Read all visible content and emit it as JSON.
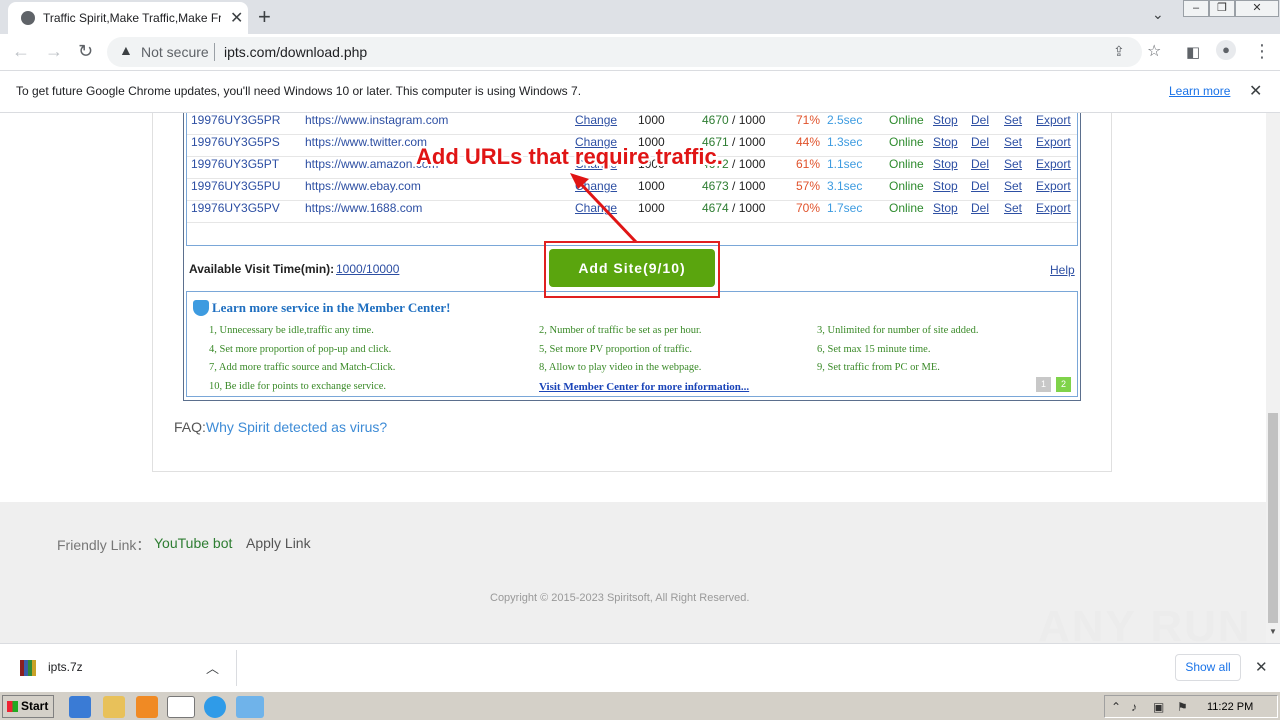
{
  "browser": {
    "tab_title": "Traffic Spirit,Make Traffic,Make Free",
    "security_label": "Not secure",
    "url": "ipts.com/download.php",
    "infobar_message": "To get future Google Chrome updates, you'll need Windows 10 or later. This computer is using Windows 7.",
    "infobar_link": "Learn more"
  },
  "sites": [
    {
      "id": "19976UY3G5PR",
      "url": "https://www.instagram.com",
      "change": "Change",
      "total": "1000",
      "visits": "4670",
      "visits_total": "1000",
      "pct": "71%",
      "sec": "2.5sec",
      "status": "Online",
      "stop": "Stop",
      "del": "Del",
      "set": "Set",
      "export": "Export"
    },
    {
      "id": "19976UY3G5PS",
      "url": "https://www.twitter.com",
      "change": "Change",
      "total": "1000",
      "visits": "4671",
      "visits_total": "1000",
      "pct": "44%",
      "sec": "1.3sec",
      "status": "Online",
      "stop": "Stop",
      "del": "Del",
      "set": "Set",
      "export": "Export"
    },
    {
      "id": "19976UY3G5PT",
      "url": "https://www.amazon.com",
      "change": "Change",
      "total": "1000",
      "visits": "4672",
      "visits_total": "1000",
      "pct": "61%",
      "sec": "1.1sec",
      "status": "Online",
      "stop": "Stop",
      "del": "Del",
      "set": "Set",
      "export": "Export"
    },
    {
      "id": "19976UY3G5PU",
      "url": "https://www.ebay.com",
      "change": "Change",
      "total": "1000",
      "visits": "4673",
      "visits_total": "1000",
      "pct": "57%",
      "sec": "3.1sec",
      "status": "Online",
      "stop": "Stop",
      "del": "Del",
      "set": "Set",
      "export": "Export"
    },
    {
      "id": "19976UY3G5PV",
      "url": "https://www.1688.com",
      "change": "Change",
      "total": "1000",
      "visits": "4674",
      "visits_total": "1000",
      "pct": "70%",
      "sec": "1.7sec",
      "status": "Online",
      "stop": "Stop",
      "del": "Del",
      "set": "Set",
      "export": "Export"
    }
  ],
  "app": {
    "avail_label": "Available Visit Time(min):",
    "avail_value": "1000/10000",
    "add_site": "Add Site(9/10)",
    "help": "Help",
    "annotation": "Add URLs that require traffic."
  },
  "member": {
    "heading": "Learn more service in the Member Center!",
    "items": [
      "1, Unnecessary be idle,traffic any time.",
      "2, Number of traffic be set as per hour.",
      "3, Unlimited for number of site added.",
      "4, Set more proportion of pop-up and click.",
      "5, Set more PV proportion of traffic.",
      "6, Set max 15 minute time.",
      "7, Add more traffic source and Match-Click.",
      "8, Allow to play video in the webpage.",
      "9, Set traffic from PC or ME.",
      "10, Be idle for points to exchange service."
    ],
    "visit_link": "Visit Member Center for more information...",
    "pages": [
      "1",
      "2"
    ]
  },
  "faq": {
    "label": "FAQ:",
    "link": "Why Spirit detected as virus?"
  },
  "footer": {
    "friendly": "Friendly Link：",
    "youtube": "YouTube bot",
    "apply": "Apply Link",
    "copyright": "Copyright © 2015-2023 Spiritsoft, All Right Reserved.",
    "watermark": "ANY RUN"
  },
  "downloads": {
    "filename": "ipts.7z",
    "show_all": "Show all"
  },
  "taskbar": {
    "start": "Start",
    "time": "11:22 PM"
  }
}
